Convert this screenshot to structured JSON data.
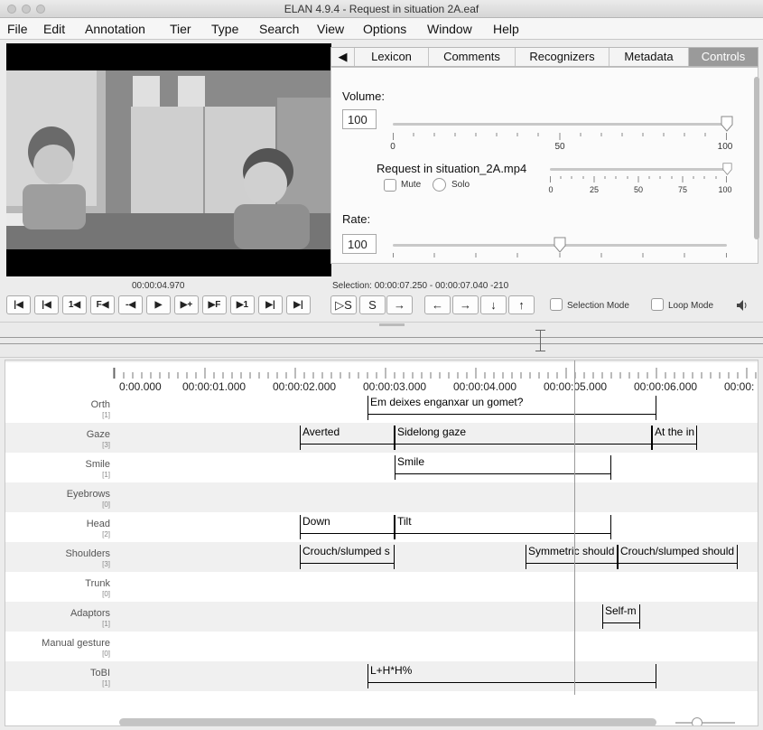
{
  "window": {
    "title": "ELAN 4.9.4 - Request in situation 2A.eaf"
  },
  "menu": [
    "File",
    "Edit",
    "Annotation",
    "Tier",
    "Type",
    "Search",
    "View",
    "Options",
    "Window",
    "Help"
  ],
  "tabs": {
    "back_arrow": "◀",
    "items": [
      "Lexicon",
      "Comments",
      "Recognizers",
      "Metadata",
      "Controls"
    ],
    "active": "Controls"
  },
  "controls": {
    "volume_label": "Volume:",
    "volume_value": "100",
    "volume_level": 1.0,
    "volume_ticks": [
      "0",
      "50",
      "100"
    ],
    "media_name": "Request in situation_2A.mp4",
    "media_volume_level": 1.0,
    "media_ticks": [
      "0",
      "25",
      "50",
      "75",
      "100"
    ],
    "mute_label": "Mute",
    "solo_label": "Solo",
    "rate_label": "Rate:",
    "rate_value": "100",
    "rate_level": 0.5
  },
  "player": {
    "current_time": "00:00:04.970",
    "selection": "Selection: 00:00:07.250 - 00:00:07.040  -210",
    "buttons": [
      "|◀",
      "|◀",
      "1◀",
      "F◀",
      "-◀",
      "▶",
      "▶+",
      "▶F",
      "▶1",
      "▶|",
      "▶|"
    ],
    "selection_buttons": [
      "▷S",
      "S",
      "→"
    ],
    "arrow_buttons": [
      "←",
      "→",
      "↓",
      "↑"
    ],
    "selection_mode_label": "Selection Mode",
    "loop_mode_label": "Loop Mode",
    "volume_icon": "speaker-icon"
  },
  "ruler": [
    "0:00.000",
    "00:00:01.000",
    "00:00:02.000",
    "00:00:03.000",
    "00:00:04.000",
    "00:00:05.000",
    "00:00:06.000",
    "00:00:"
  ],
  "tiers": [
    {
      "name": "Orth",
      "count": "[1]",
      "annotations": [
        {
          "text": "Em deixes enganxar un gomet?",
          "start": 2.8,
          "end": 6.0
        }
      ]
    },
    {
      "name": "Gaze",
      "count": "[3]",
      "annotations": [
        {
          "text": "Averted",
          "start": 2.05,
          "end": 3.1
        },
        {
          "text": "Sidelong gaze",
          "start": 3.1,
          "end": 5.95
        },
        {
          "text": "At the in",
          "start": 5.95,
          "end": 6.45
        }
      ]
    },
    {
      "name": "Smile",
      "count": "[1]",
      "annotations": [
        {
          "text": "Smile",
          "start": 3.1,
          "end": 5.5
        }
      ]
    },
    {
      "name": "Eyebrows",
      "count": "[0]",
      "annotations": []
    },
    {
      "name": "Head",
      "count": "[2]",
      "annotations": [
        {
          "text": "Down",
          "start": 2.05,
          "end": 3.1
        },
        {
          "text": "Tilt",
          "start": 3.1,
          "end": 5.5
        }
      ]
    },
    {
      "name": "Shoulders",
      "count": "[3]",
      "annotations": [
        {
          "text": "Crouch/slumped s",
          "start": 2.05,
          "end": 3.1
        },
        {
          "text": "Symmetric should",
          "start": 4.55,
          "end": 5.57
        },
        {
          "text": "Crouch/slumped should",
          "start": 5.57,
          "end": 6.9
        }
      ]
    },
    {
      "name": "Trunk",
      "count": "[0]",
      "annotations": []
    },
    {
      "name": "Adaptors",
      "count": "[1]",
      "annotations": [
        {
          "text": "Self-m",
          "start": 5.4,
          "end": 5.82
        }
      ]
    },
    {
      "name": "Manual gesture",
      "count": "[0]",
      "annotations": []
    },
    {
      "name": "ToBI",
      "count": "[1]",
      "annotations": [
        {
          "text": "L+H*H%",
          "start": 2.8,
          "end": 6.0
        }
      ]
    }
  ]
}
